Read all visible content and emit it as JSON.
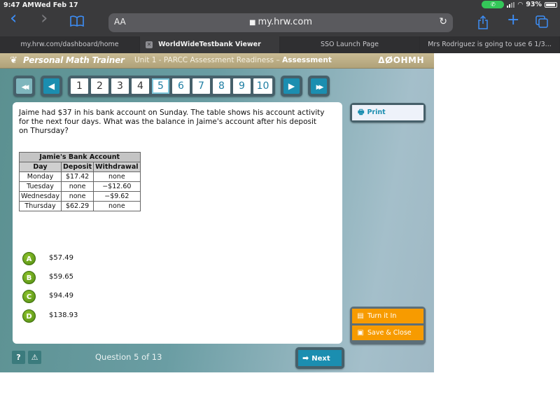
{
  "status_bar": {
    "time": "9:47 AM",
    "date": "Wed Feb 17",
    "battery": "93%",
    "call_icon": "phone-icon",
    "wifi_icon": "wifi-icon"
  },
  "browser": {
    "text_size_label": "AA",
    "url": "my.hrw.com",
    "icons": {
      "back": "‹",
      "forward": "›",
      "bookmarks": "📖",
      "reload": "↻",
      "share": "⇪",
      "new_tab": "+",
      "tabs": "⧉",
      "lock": "🔒"
    },
    "tabs": [
      {
        "label": "my.hrw.com/dashboard/home",
        "active": false
      },
      {
        "label": "WorldWideTestbank Viewer",
        "active": true
      },
      {
        "label": "SSO Launch Page",
        "active": false
      },
      {
        "label": "Mrs Rodriguez is going to use 6 1/3...",
        "active": false
      }
    ],
    "tab_close_glyph": "✕"
  },
  "app": {
    "logo_text": "Personal Math Trainer",
    "unit_title": "Unit 1 - PARCC Assessment Readiness – ",
    "unit_title_bold": "Assessment",
    "publisher": "ΔⵁOHMH",
    "nav": {
      "first_glyph": "◀◀",
      "prev_glyph": "◀",
      "next_glyph": "▶",
      "last_glyph": "▶▶",
      "pages": [
        "1",
        "2",
        "3",
        "4",
        "5",
        "6",
        "7",
        "8",
        "9",
        "10"
      ],
      "current_page": "5"
    },
    "question": {
      "text": "Jaime had $37 in his bank account on Sunday. The table shows his account activity for the next four days. What was the balance in Jaime's account after his deposit on Thursday?",
      "table": {
        "caption": "Jamie's Bank Account",
        "headers": [
          "Day",
          "Deposit",
          "Withdrawal"
        ],
        "rows": [
          [
            "Monday",
            "$17.42",
            "none"
          ],
          [
            "Tuesday",
            "none",
            "−$12.60"
          ],
          [
            "Wednesday",
            "none",
            "−$9.62"
          ],
          [
            "Thursday",
            "$62.29",
            "none"
          ]
        ]
      },
      "choices": [
        {
          "letter": "A",
          "value": "$57.49"
        },
        {
          "letter": "B",
          "value": "$59.65"
        },
        {
          "letter": "C",
          "value": "$94.49"
        },
        {
          "letter": "D",
          "value": "$138.93"
        }
      ]
    },
    "print_label": "Print",
    "turn_in_label": "Turn it In",
    "save_close_label": "Save & Close",
    "help_glyph": "?",
    "report_glyph": "⚠",
    "counter": "Question 5 of 13",
    "next_label": "Next"
  },
  "colors": {
    "nav_blue": "#1b8eb0",
    "answer_green": "#5f9b17",
    "action_orange": "#f79b00",
    "header_tan": "#b9ab84"
  }
}
